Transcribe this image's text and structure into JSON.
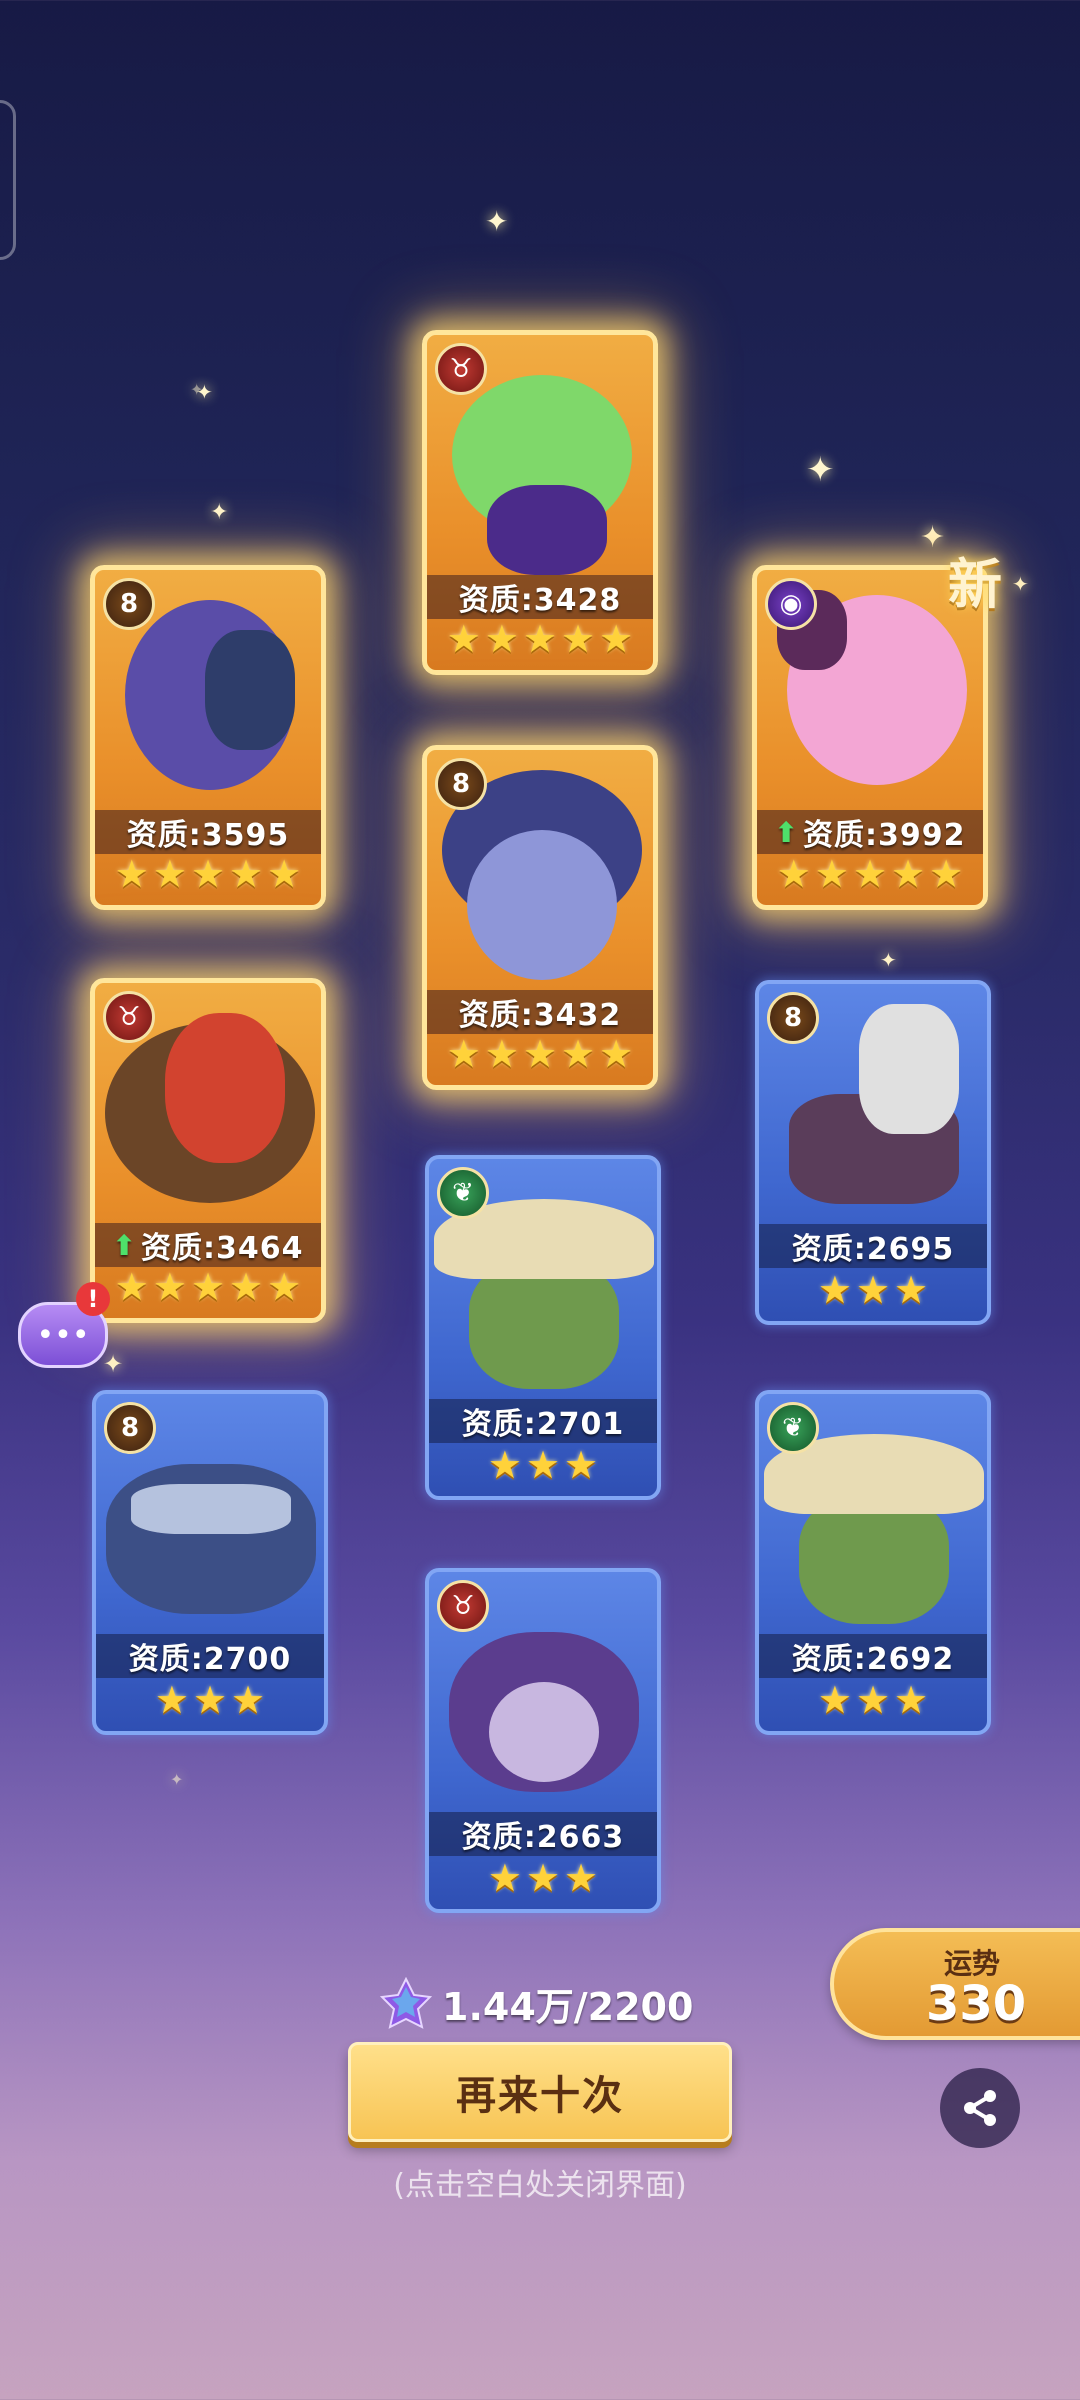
{
  "cards": [
    {
      "id": "card-1",
      "rarity": "gold",
      "faction": "gold",
      "faction_glyph": "8",
      "quality_label": "资质:3595",
      "upgrade": false,
      "stars": 5,
      "art_color": "#5a4da8",
      "art_accent": "#2e3d6a"
    },
    {
      "id": "card-2",
      "rarity": "gold",
      "faction": "red",
      "faction_glyph": "♉",
      "quality_label": "资质:3428",
      "upgrade": false,
      "stars": 5,
      "art_color": "#7fd86a",
      "art_accent": "#4b2b8a"
    },
    {
      "id": "card-3",
      "rarity": "gold",
      "faction": "purple",
      "faction_glyph": "◉",
      "quality_label": "资质:3992",
      "upgrade": true,
      "stars": 5,
      "art_color": "#f3a6d4",
      "art_accent": "#5b2a5a"
    },
    {
      "id": "card-4",
      "rarity": "gold",
      "faction": "gold",
      "faction_glyph": "8",
      "quality_label": "资质:3432",
      "upgrade": false,
      "stars": 5,
      "art_color": "#8e96d8",
      "art_accent": "#3c4186"
    },
    {
      "id": "card-5",
      "rarity": "gold",
      "faction": "red",
      "faction_glyph": "♉",
      "quality_label": "资质:3464",
      "upgrade": true,
      "stars": 5,
      "art_color": "#d2432f",
      "art_accent": "#6b4527"
    },
    {
      "id": "card-6",
      "rarity": "blue",
      "faction": "gold",
      "faction_glyph": "8",
      "quality_label": "资质:2695",
      "upgrade": false,
      "stars": 3,
      "art_color": "#e0e0e0",
      "art_accent": "#5a3d5a"
    },
    {
      "id": "card-7",
      "rarity": "blue",
      "faction": "green",
      "faction_glyph": "❦",
      "quality_label": "资质:2701",
      "upgrade": false,
      "stars": 3,
      "art_color": "#6f9a4d",
      "art_accent": "#e8dcb4"
    },
    {
      "id": "card-8",
      "rarity": "blue",
      "faction": "gold",
      "faction_glyph": "8",
      "quality_label": "资质:2700",
      "upgrade": false,
      "stars": 3,
      "art_color": "#3c4f86",
      "art_accent": "#b5c2de"
    },
    {
      "id": "card-9",
      "rarity": "blue",
      "faction": "green",
      "faction_glyph": "❦",
      "quality_label": "资质:2692",
      "upgrade": false,
      "stars": 3,
      "art_color": "#6f9a4d",
      "art_accent": "#e8dcb4"
    },
    {
      "id": "card-10",
      "rarity": "blue",
      "faction": "red",
      "faction_glyph": "♉",
      "quality_label": "资质:2663",
      "upgrade": false,
      "stars": 3,
      "art_color": "#5b3d8e",
      "art_accent": "#c8b7e0"
    }
  ],
  "new_badge": "新",
  "currency": {
    "value": "1.44万/2200",
    "icon": "purple-crystal-icon"
  },
  "again_button": "再来十次",
  "hint": "(点击空白处关闭界面)",
  "luck": {
    "label": "运势",
    "value": "330"
  },
  "share_icon": "share-icon",
  "chat_icon": "chat-bubble-icon",
  "colors": {
    "gold_border": "#ffe69b",
    "blue_border": "#82a6f4",
    "star": "#ffd23a",
    "upgrade_arrow": "#4ee06a"
  }
}
